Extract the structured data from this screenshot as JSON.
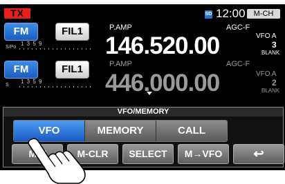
{
  "status_bar": {
    "tx_label": "TX",
    "sd_icon": "sd-card-icon",
    "sd_label": "SD",
    "time": "12:00",
    "channel_badge": "M-CH"
  },
  "vfo_main": {
    "mode": "FM",
    "filter": "FIL1",
    "meter_label": "S/Po",
    "meter_scale": "1 3 5 9",
    "pamp": "P.AMP",
    "agc": "AGC-F",
    "frequency": "146.520.00",
    "vfo_label": "VFO A",
    "vfo_number": "3",
    "blank_label": "BLANK"
  },
  "vfo_sub": {
    "mode": "FM",
    "filter": "FIL1",
    "meter_label": "S",
    "meter_scale": "1 3 5 9",
    "pamp": "P.AMP",
    "agc": "AGC-F",
    "frequency": "446.000.00",
    "vfo_label": "VFO A",
    "vfo_number": "2",
    "blank_label": "BLANK"
  },
  "panel": {
    "title": "VFO/MEMORY",
    "segments": [
      "VFO",
      "MEMORY",
      "CALL"
    ],
    "active_segment": "VFO",
    "buttons": [
      "MW",
      "M-CLR",
      "SELECT",
      "M→VFO",
      "↩"
    ]
  },
  "colors": {
    "tx_red": "#e8201c",
    "accent_blue": "#1c5cc0",
    "dim_text": "#9a9a9a"
  }
}
